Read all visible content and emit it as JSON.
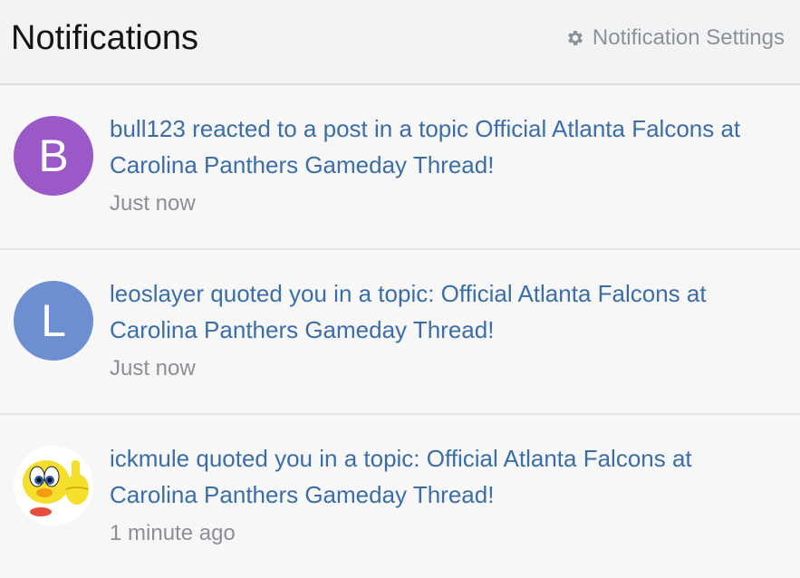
{
  "header": {
    "title": "Notifications",
    "settings_label": "Notification Settings",
    "settings_icon": "gear-icon"
  },
  "notifications": [
    {
      "avatar_letter": "B",
      "avatar_color": "#9b59c7",
      "message": "bull123 reacted to a post in a topic Official Atlanta Falcons at Carolina Panthers Gameday Thread!",
      "time": "Just now"
    },
    {
      "avatar_letter": "L",
      "avatar_color": "#6b8fd0",
      "message": "leoslayer quoted you in a topic: Official Atlanta Falcons at Carolina Panthers Gameday Thread!",
      "time": "Just now"
    },
    {
      "avatar_image": "tweety-bird-avatar",
      "message": "ickmule quoted you in a topic: Official Atlanta Falcons at Carolina Panthers Gameday Thread!",
      "time": "1 minute ago"
    }
  ],
  "colors": {
    "link": "#3b6ea8",
    "muted": "#8b8f95",
    "header_bg": "#f3f3f4"
  }
}
